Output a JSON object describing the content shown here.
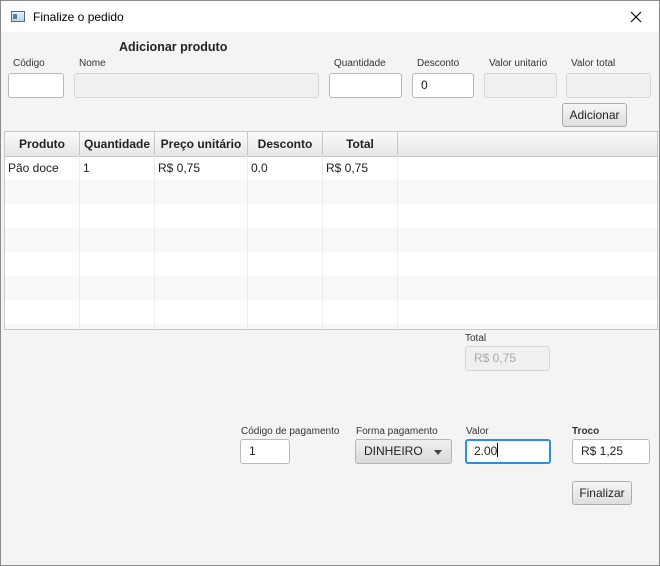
{
  "window": {
    "title": "Finalize o pedido"
  },
  "add_product": {
    "section_title": "Adicionar produto",
    "code_label": "Código",
    "code_value": "",
    "name_label": "Nome",
    "name_value": "",
    "quantity_label": "Quantidade",
    "quantity_value": "",
    "discount_label": "Desconto",
    "discount_value": "0",
    "unit_value_label": "Valor unitario",
    "unit_value_value": "",
    "total_value_label": "Valor total",
    "total_value_value": "",
    "add_button": "Adicionar"
  },
  "table": {
    "columns": [
      "Produto",
      "Quantidade",
      "Preço unitário",
      "Desconto",
      "Total"
    ],
    "rows": [
      [
        "Pão doce",
        "1",
        "R$ 0,75",
        "0.0",
        "R$ 0,75"
      ]
    ]
  },
  "totals": {
    "total_label": "Total",
    "total_value": "R$ 0,75"
  },
  "payment": {
    "code_label": "Código de pagamento",
    "code_value": "1",
    "method_label": "Forma pagamento",
    "method_value": "DINHEIRO",
    "amount_label": "Valor",
    "amount_value": "2.00",
    "change_label": "Troco",
    "change_value": "R$ 1,25",
    "finish_button": "Finalizar"
  }
}
